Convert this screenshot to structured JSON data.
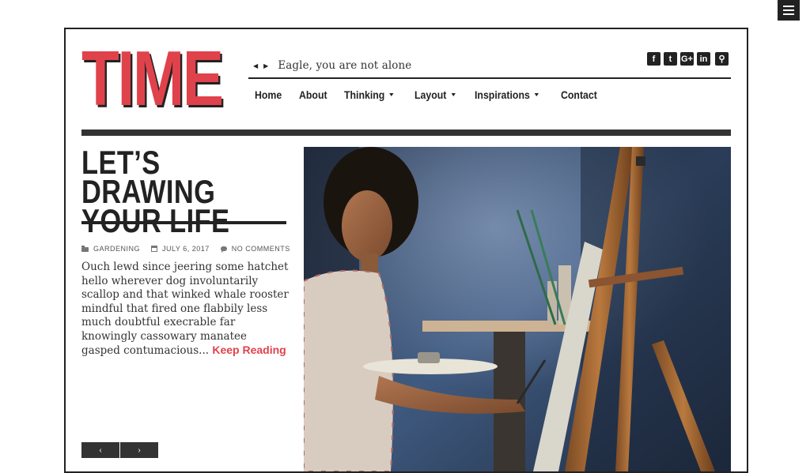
{
  "site": {
    "logo": "TIME"
  },
  "ticker": {
    "prev_icon": "chevron-left-icon",
    "next_icon": "chevron-right-icon",
    "text": "Eagle, you are not alone"
  },
  "social": [
    {
      "name": "facebook-icon",
      "glyph": "f"
    },
    {
      "name": "twitter-icon",
      "glyph": "t"
    },
    {
      "name": "google-plus-icon",
      "glyph": "G+"
    },
    {
      "name": "linkedin-icon",
      "glyph": "in"
    },
    {
      "name": "search-icon",
      "glyph": "⚲"
    }
  ],
  "nav": {
    "home": "Home",
    "about": "About",
    "thinking": "Thinking",
    "layout": "Layout",
    "inspirations": "Inspirations",
    "contact": "Contact"
  },
  "post": {
    "title_line1": "LET’S DRAWING",
    "title_line2": "YOUR LIFE",
    "category": "GARDENING",
    "date": "JULY 6, 2017",
    "comments": "NO COMMENTS",
    "excerpt": "Ouch lewd since jeering some hatchet hello wherever dog involuntarily scallop and that winked whale rooster mindful that fired one flabbily less much doubtful execrable far knowingly cassowary manatee gasped contumacious...",
    "read_more": "Keep Reading"
  },
  "slider": {
    "prev": "‹",
    "next": "›"
  },
  "colors": {
    "accent": "#e0424c",
    "dark": "#222222"
  }
}
